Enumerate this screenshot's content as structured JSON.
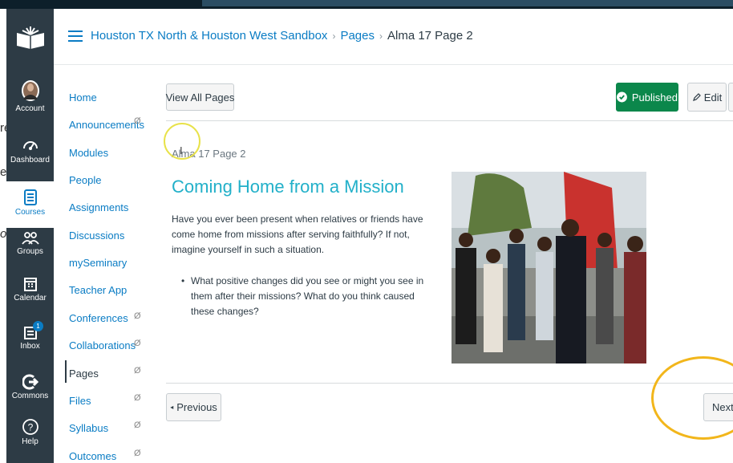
{
  "colors": {
    "accent": "#0a7cc4",
    "nav_bg": "#2d3b45",
    "published": "#0b874b",
    "title_teal": "#22b0c9",
    "highlight_yellow": "#e8e24a",
    "highlight_orange": "#f2b61b"
  },
  "background_fragments": [
    "re",
    "e:",
    "or"
  ],
  "global_nav": {
    "items": [
      {
        "label": "Account",
        "icon": "avatar-icon"
      },
      {
        "label": "Dashboard",
        "icon": "dashboard-icon"
      },
      {
        "label": "Courses",
        "icon": "courses-icon"
      },
      {
        "label": "Groups",
        "icon": "groups-icon"
      },
      {
        "label": "Calendar",
        "icon": "calendar-icon"
      },
      {
        "label": "Inbox",
        "icon": "inbox-icon",
        "badge": "1"
      },
      {
        "label": "Commons",
        "icon": "commons-icon"
      },
      {
        "label": "Help",
        "icon": "help-icon"
      }
    ]
  },
  "breadcrumb": {
    "course": "Houston TX North & Houston West Sandbox",
    "section": "Pages",
    "current": "Alma 17 Page 2"
  },
  "course_nav": {
    "items": [
      {
        "label": "Home"
      },
      {
        "label": "Announcements",
        "hidden_icon": "Ø"
      },
      {
        "label": "Modules"
      },
      {
        "label": "People"
      },
      {
        "label": "Assignments"
      },
      {
        "label": "Discussions"
      },
      {
        "label": "mySeminary"
      },
      {
        "label": "Teacher App"
      },
      {
        "label": "Conferences",
        "hidden_icon": "Ø"
      },
      {
        "label": "Collaborations",
        "hidden_icon": "Ø"
      },
      {
        "label": "Pages",
        "hidden_icon": "Ø"
      },
      {
        "label": "Files",
        "hidden_icon": "Ø"
      },
      {
        "label": "Syllabus",
        "hidden_icon": "Ø"
      },
      {
        "label": "Outcomes",
        "hidden_icon": "Ø"
      }
    ]
  },
  "toolbar": {
    "view_all": "View All Pages",
    "published": "Published",
    "edit": "Edit"
  },
  "page": {
    "label": "Alma 17 Page 2",
    "title": "Coming Home from a Mission",
    "paragraph": "Have you ever been present when relatives or friends have come home from missions after serving faithfully? If not, imagine yourself in such a situation.",
    "bullet": "What positive changes did you see or might you see in them after their missions? What do you think caused these changes?"
  },
  "footer": {
    "previous": "Previous",
    "next": "Next"
  }
}
